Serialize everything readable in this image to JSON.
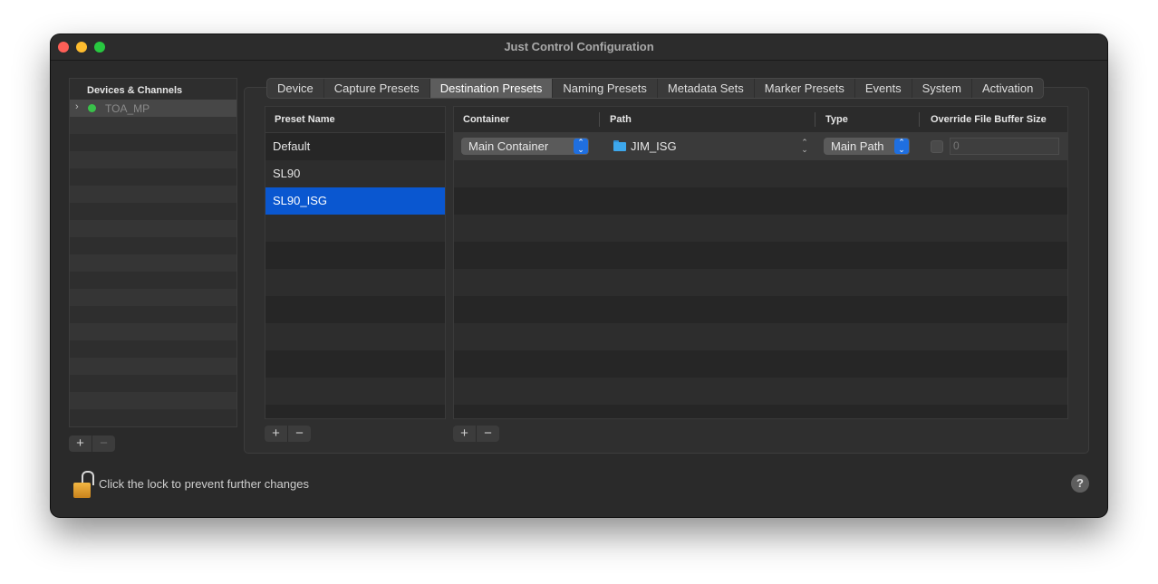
{
  "window": {
    "title": "Just Control Configuration"
  },
  "sidebar": {
    "header": "Devices & Channels",
    "device": {
      "name": "TOA_MP",
      "status_color": "#39c14a"
    },
    "add_label": "+",
    "remove_label": "−"
  },
  "tabs": [
    {
      "label": "Device"
    },
    {
      "label": "Capture Presets"
    },
    {
      "label": "Destination Presets",
      "active": true
    },
    {
      "label": "Naming Presets"
    },
    {
      "label": "Metadata Sets"
    },
    {
      "label": "Marker Presets"
    },
    {
      "label": "Events"
    },
    {
      "label": "System"
    },
    {
      "label": "Activation"
    }
  ],
  "presets": {
    "header": "Preset Name",
    "items": [
      "Default",
      "SL90",
      "SL90_ISG"
    ],
    "selected": "SL90_ISG",
    "add_label": "+",
    "remove_label": "−"
  },
  "destinations": {
    "headers": {
      "container": "Container",
      "path": "Path",
      "type": "Type",
      "override": "Override File Buffer Size"
    },
    "rows": [
      {
        "container": "Main Container",
        "path": "JIM_ISG",
        "type": "Main Path",
        "override_checked": false,
        "buffer_size": "0"
      }
    ],
    "add_label": "+",
    "remove_label": "−"
  },
  "footer": {
    "lock_text": "Click the lock to prevent further changes",
    "help_label": "?"
  },
  "colors": {
    "accent": "#0a57d0",
    "popup_arrow": "#1f6fe0",
    "folder": "#3da7ec"
  }
}
